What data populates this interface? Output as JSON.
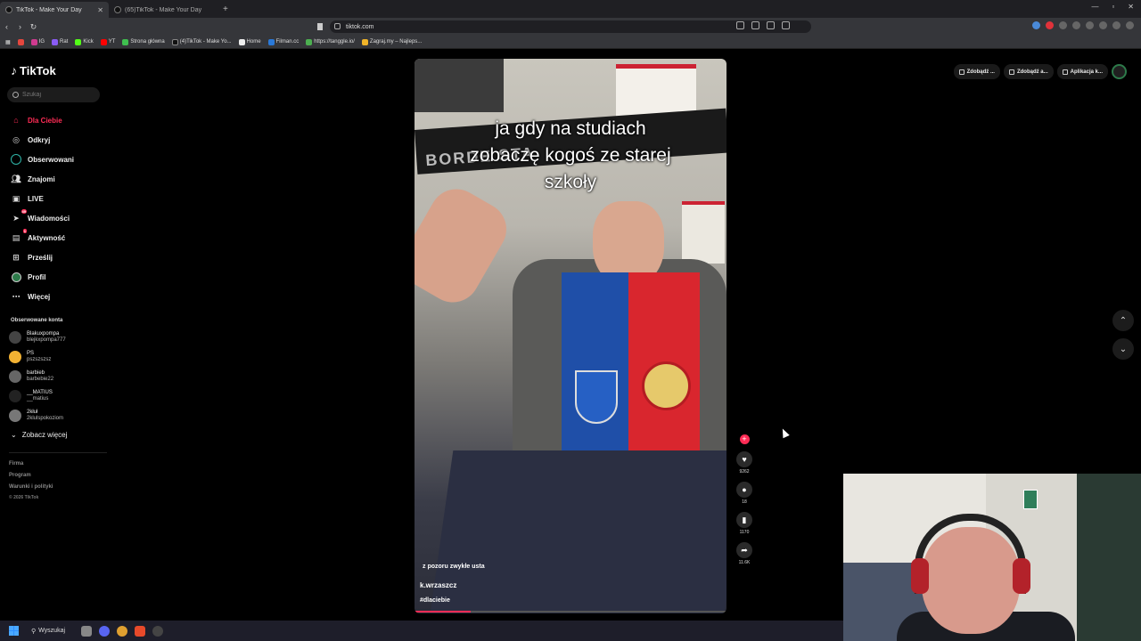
{
  "browser": {
    "tabs": [
      {
        "title": "TikTok - Make Your Day",
        "active": true
      },
      {
        "title": "(65)TikTok - Make Your Day",
        "active": false
      }
    ],
    "url": "tiktok.com",
    "bookmarks": [
      "IG",
      "Rat",
      "Kick",
      "YT",
      "Strona główna",
      "(4)TikTok - Make Yo...",
      "Home",
      "Filman.cc",
      "https://tanggle.io/",
      "Zagraj.my – Najleps..."
    ]
  },
  "sidebar": {
    "logo": "TikTok",
    "search_placeholder": "Szukaj",
    "menu": [
      {
        "label": "Dla Ciebie",
        "icon": "home-icon"
      },
      {
        "label": "Odkryj",
        "icon": "compass-icon"
      },
      {
        "label": "Obserwowani",
        "icon": "following-icon"
      },
      {
        "label": "Znajomi",
        "icon": "friends-icon"
      },
      {
        "label": "LIVE",
        "icon": "live-icon"
      },
      {
        "label": "Wiadomości",
        "icon": "messages-icon",
        "badge": "49"
      },
      {
        "label": "Aktywność",
        "icon": "activity-icon",
        "badge": "1"
      },
      {
        "label": "Prześlij",
        "icon": "upload-icon"
      },
      {
        "label": "Profil",
        "icon": "profile-icon"
      },
      {
        "label": "Więcej",
        "icon": "more-icon"
      }
    ],
    "followed_title": "Obserwowane konta",
    "followed": [
      {
        "name": "Blakuxpompa",
        "handle": "blejkxpompa777"
      },
      {
        "name": "PS",
        "handle": "pszszszsz"
      },
      {
        "name": "barbieb",
        "handle": "barbebie22"
      },
      {
        "name": "__MATIUS",
        "handle": "__matius"
      },
      {
        "name": "2kłuł",
        "handle": "2klulspokoziom"
      }
    ],
    "see_more": "Zobacz więcej",
    "footer": [
      "Firma",
      "Program",
      "Warunki i polityki"
    ],
    "copyright": "© 2026 TikTok"
  },
  "video": {
    "caption_lines": [
      "ja gdy na studiach",
      "zobaczę kogoś ze starej",
      "szkoły"
    ],
    "scarf_text": "BORDE  STA",
    "description": "z pozoru zwykłe usta",
    "username": "k.wrzaszcz",
    "hashtag": "#dlaciebie",
    "progress": 0.18
  },
  "actions": {
    "likes": "9262",
    "comments": "18",
    "saves": "1170",
    "shares": "11.6K"
  },
  "topbar": {
    "pills": [
      "Zdobądź ...",
      "Zdobądź a...",
      "Aplikacja k..."
    ]
  },
  "taskbar": {
    "search": "Wyszukaj"
  },
  "colors": {
    "accent": "#fe2c55",
    "bg": "#000000"
  }
}
